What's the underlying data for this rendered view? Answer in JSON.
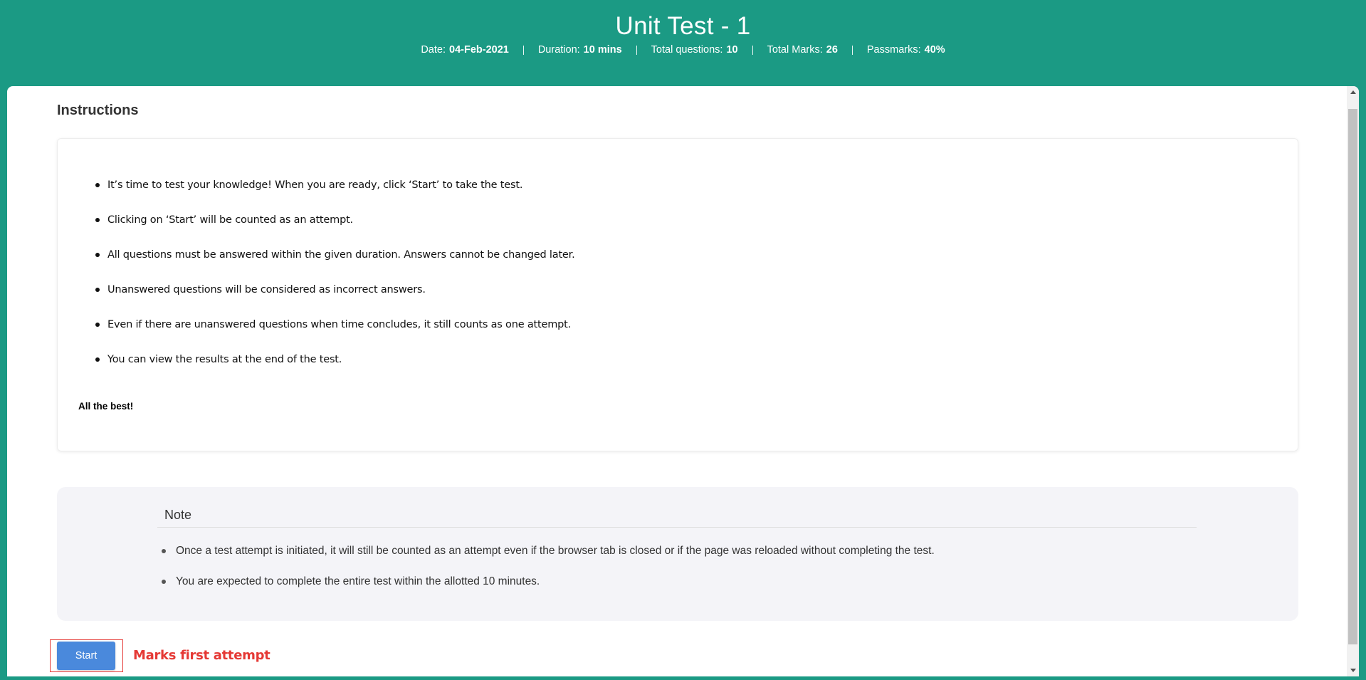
{
  "header": {
    "title": "Unit Test - 1",
    "meta": [
      {
        "label": "Date:",
        "value": "04-Feb-2021"
      },
      {
        "label": "Duration:",
        "value": "10 mins"
      },
      {
        "label": "Total questions:",
        "value": "10"
      },
      {
        "label": "Total Marks:",
        "value": "26"
      },
      {
        "label": "Passmarks:",
        "value": "40%"
      }
    ]
  },
  "instructions": {
    "heading": "Instructions",
    "items": [
      "It’s time to test your knowledge! When you are ready, click ‘Start’ to take the test.",
      "Clicking on ‘Start’ will be counted as an attempt.",
      "All questions must be answered within the given duration. Answers cannot be changed later.",
      "Unanswered questions will be considered as incorrect answers.",
      "Even if there are unanswered questions when time concludes, it still counts as one attempt.",
      "You can view the results at the end of the test."
    ],
    "closing": "All the best!"
  },
  "note": {
    "title": "Note",
    "items": [
      "Once a test attempt is initiated, it will still be counted as an attempt even if the browser tab is closed or if the page was reloaded without completing the test.",
      "You are expected to complete the entire test within the allotted 10 minutes."
    ]
  },
  "actions": {
    "start_label": "Start",
    "annotation": "Marks first attempt"
  },
  "colors": {
    "header_bg": "#1b9a84",
    "start_button": "#4a89dc",
    "annotation": "#e53935"
  }
}
